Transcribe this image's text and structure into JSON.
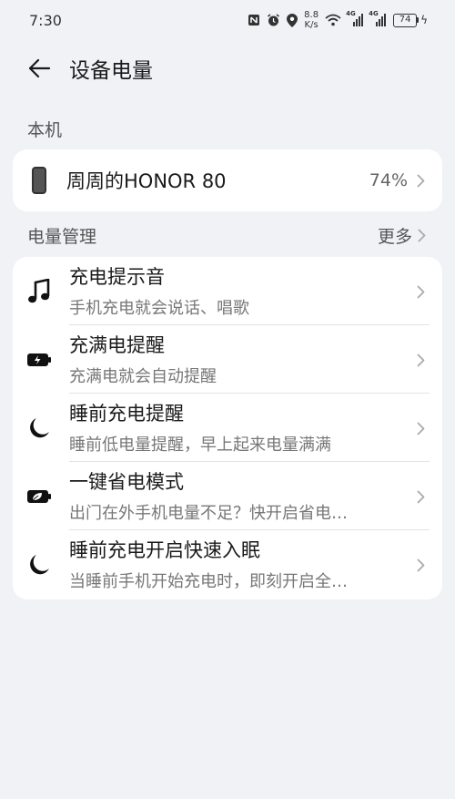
{
  "status_bar": {
    "time": "7:30",
    "net_speed_value": "8.8",
    "net_speed_unit": "K/s",
    "signal1_tag": "4G",
    "signal2_tag": "4G",
    "battery_level": "74"
  },
  "header": {
    "title": "设备电量"
  },
  "this_device": {
    "section_label": "本机",
    "device_name": "周周的HONOR 80",
    "battery_percent": "74%"
  },
  "power_management": {
    "section_label": "电量管理",
    "more_label": "更多",
    "items": [
      {
        "title": "充电提示音",
        "subtitle": "手机充电就会说话、唱歌",
        "icon": "music-note-icon"
      },
      {
        "title": "充满电提醒",
        "subtitle": "充满电就会自动提醒",
        "icon": "battery-charging-icon"
      },
      {
        "title": "睡前充电提醒",
        "subtitle": "睡前低电量提醒，早上起来电量满满",
        "icon": "moon-icon"
      },
      {
        "title": "一键省电模式",
        "subtitle": "出门在外手机电量不足？快开启省电…",
        "icon": "battery-leaf-icon"
      },
      {
        "title": "睡前充电开启快速入眠",
        "subtitle": "当睡前手机开始充电时，即刻开启全…",
        "icon": "moon-icon"
      }
    ]
  },
  "colors": {
    "background": "#f1f2f6",
    "card": "#ffffff",
    "text_primary": "#1a1a1a",
    "text_secondary": "#777777"
  }
}
